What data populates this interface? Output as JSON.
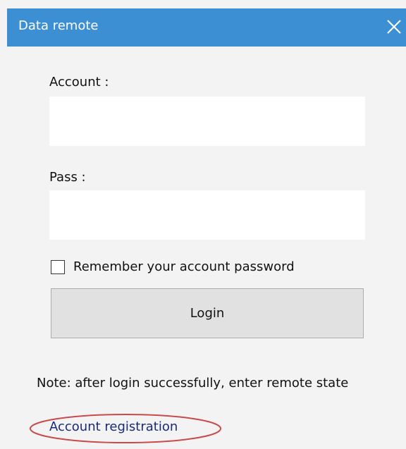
{
  "window": {
    "title": "Data remote",
    "accent_color": "#3c8fd3",
    "close_icon": "close-icon"
  },
  "form": {
    "account_label": "Account :",
    "account_value": "",
    "pass_label": "Pass :",
    "pass_value": "",
    "remember_label": "Remember your account password",
    "remember_checked": false,
    "login_label": "Login"
  },
  "footer": {
    "note": "Note: after login successfully, enter remote state",
    "registration_link": "Account registration",
    "highlight_color": "#c94a4a"
  }
}
